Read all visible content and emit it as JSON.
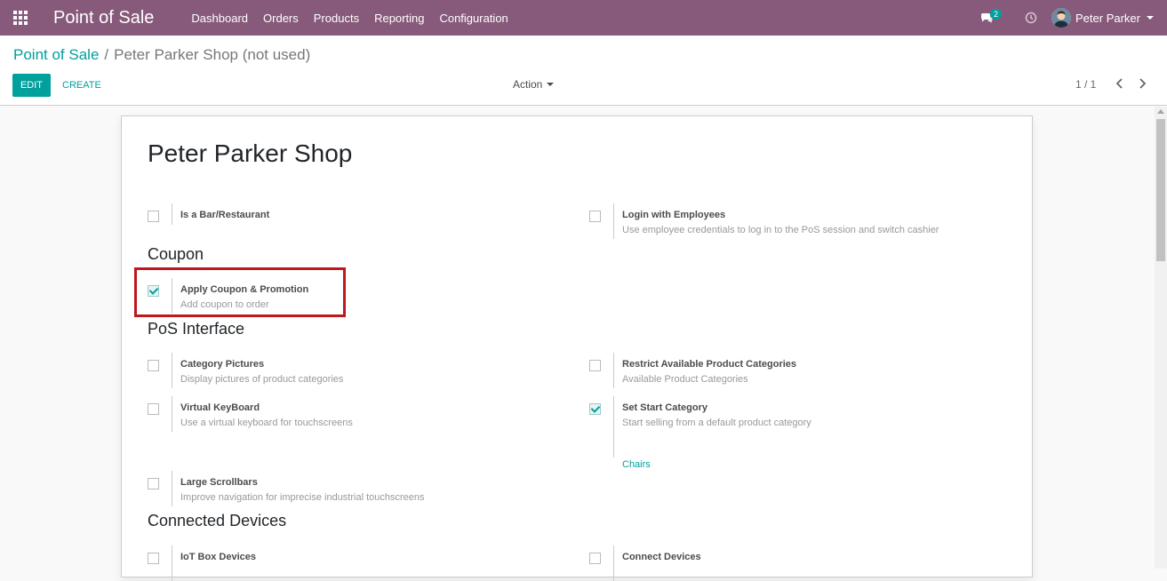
{
  "navbar": {
    "brand": "Point of Sale",
    "menu": [
      "Dashboard",
      "Orders",
      "Products",
      "Reporting",
      "Configuration"
    ],
    "chat_badge": "2",
    "user_name": "Peter Parker"
  },
  "breadcrumb": {
    "parent": "Point of Sale",
    "separator": "/",
    "current": "Peter Parker Shop (not used)"
  },
  "toolbar": {
    "edit_label": "EDIT",
    "create_label": "CREATE",
    "action_label": "Action",
    "pager": "1 / 1"
  },
  "form": {
    "title": "Peter Parker Shop",
    "sections": {
      "coupon": "Coupon",
      "pos_interface": "PoS Interface",
      "connected_devices": "Connected Devices"
    },
    "settings": {
      "bar_restaurant": {
        "label": "Is a Bar/Restaurant",
        "checked": false
      },
      "login_employees": {
        "label": "Login with Employees",
        "desc": "Use employee credentials to log in to the PoS session and switch cashier",
        "checked": false
      },
      "apply_coupon": {
        "label": "Apply Coupon & Promotion",
        "desc": "Add coupon to order",
        "checked": true
      },
      "category_pictures": {
        "label": "Category Pictures",
        "desc": "Display pictures of product categories",
        "checked": false
      },
      "restrict_categories": {
        "label": "Restrict Available Product Categories",
        "desc": "Available Product Categories",
        "checked": false
      },
      "virtual_keyboard": {
        "label": "Virtual KeyBoard",
        "desc": "Use a virtual keyboard for touchscreens",
        "checked": false
      },
      "start_category": {
        "label": "Set Start Category",
        "desc": "Start selling from a default product category",
        "value": "Chairs",
        "checked": true
      },
      "large_scrollbars": {
        "label": "Large Scrollbars",
        "desc": "Improve navigation for imprecise industrial touchscreens",
        "checked": false
      },
      "iot_box": {
        "label": "IoT Box Devices",
        "checked": false
      },
      "connect_devices": {
        "label": "Connect Devices",
        "checked": false
      }
    }
  },
  "colors": {
    "navbar": "#875a7b",
    "accent": "#00a09d",
    "highlight": "#c0171d"
  }
}
